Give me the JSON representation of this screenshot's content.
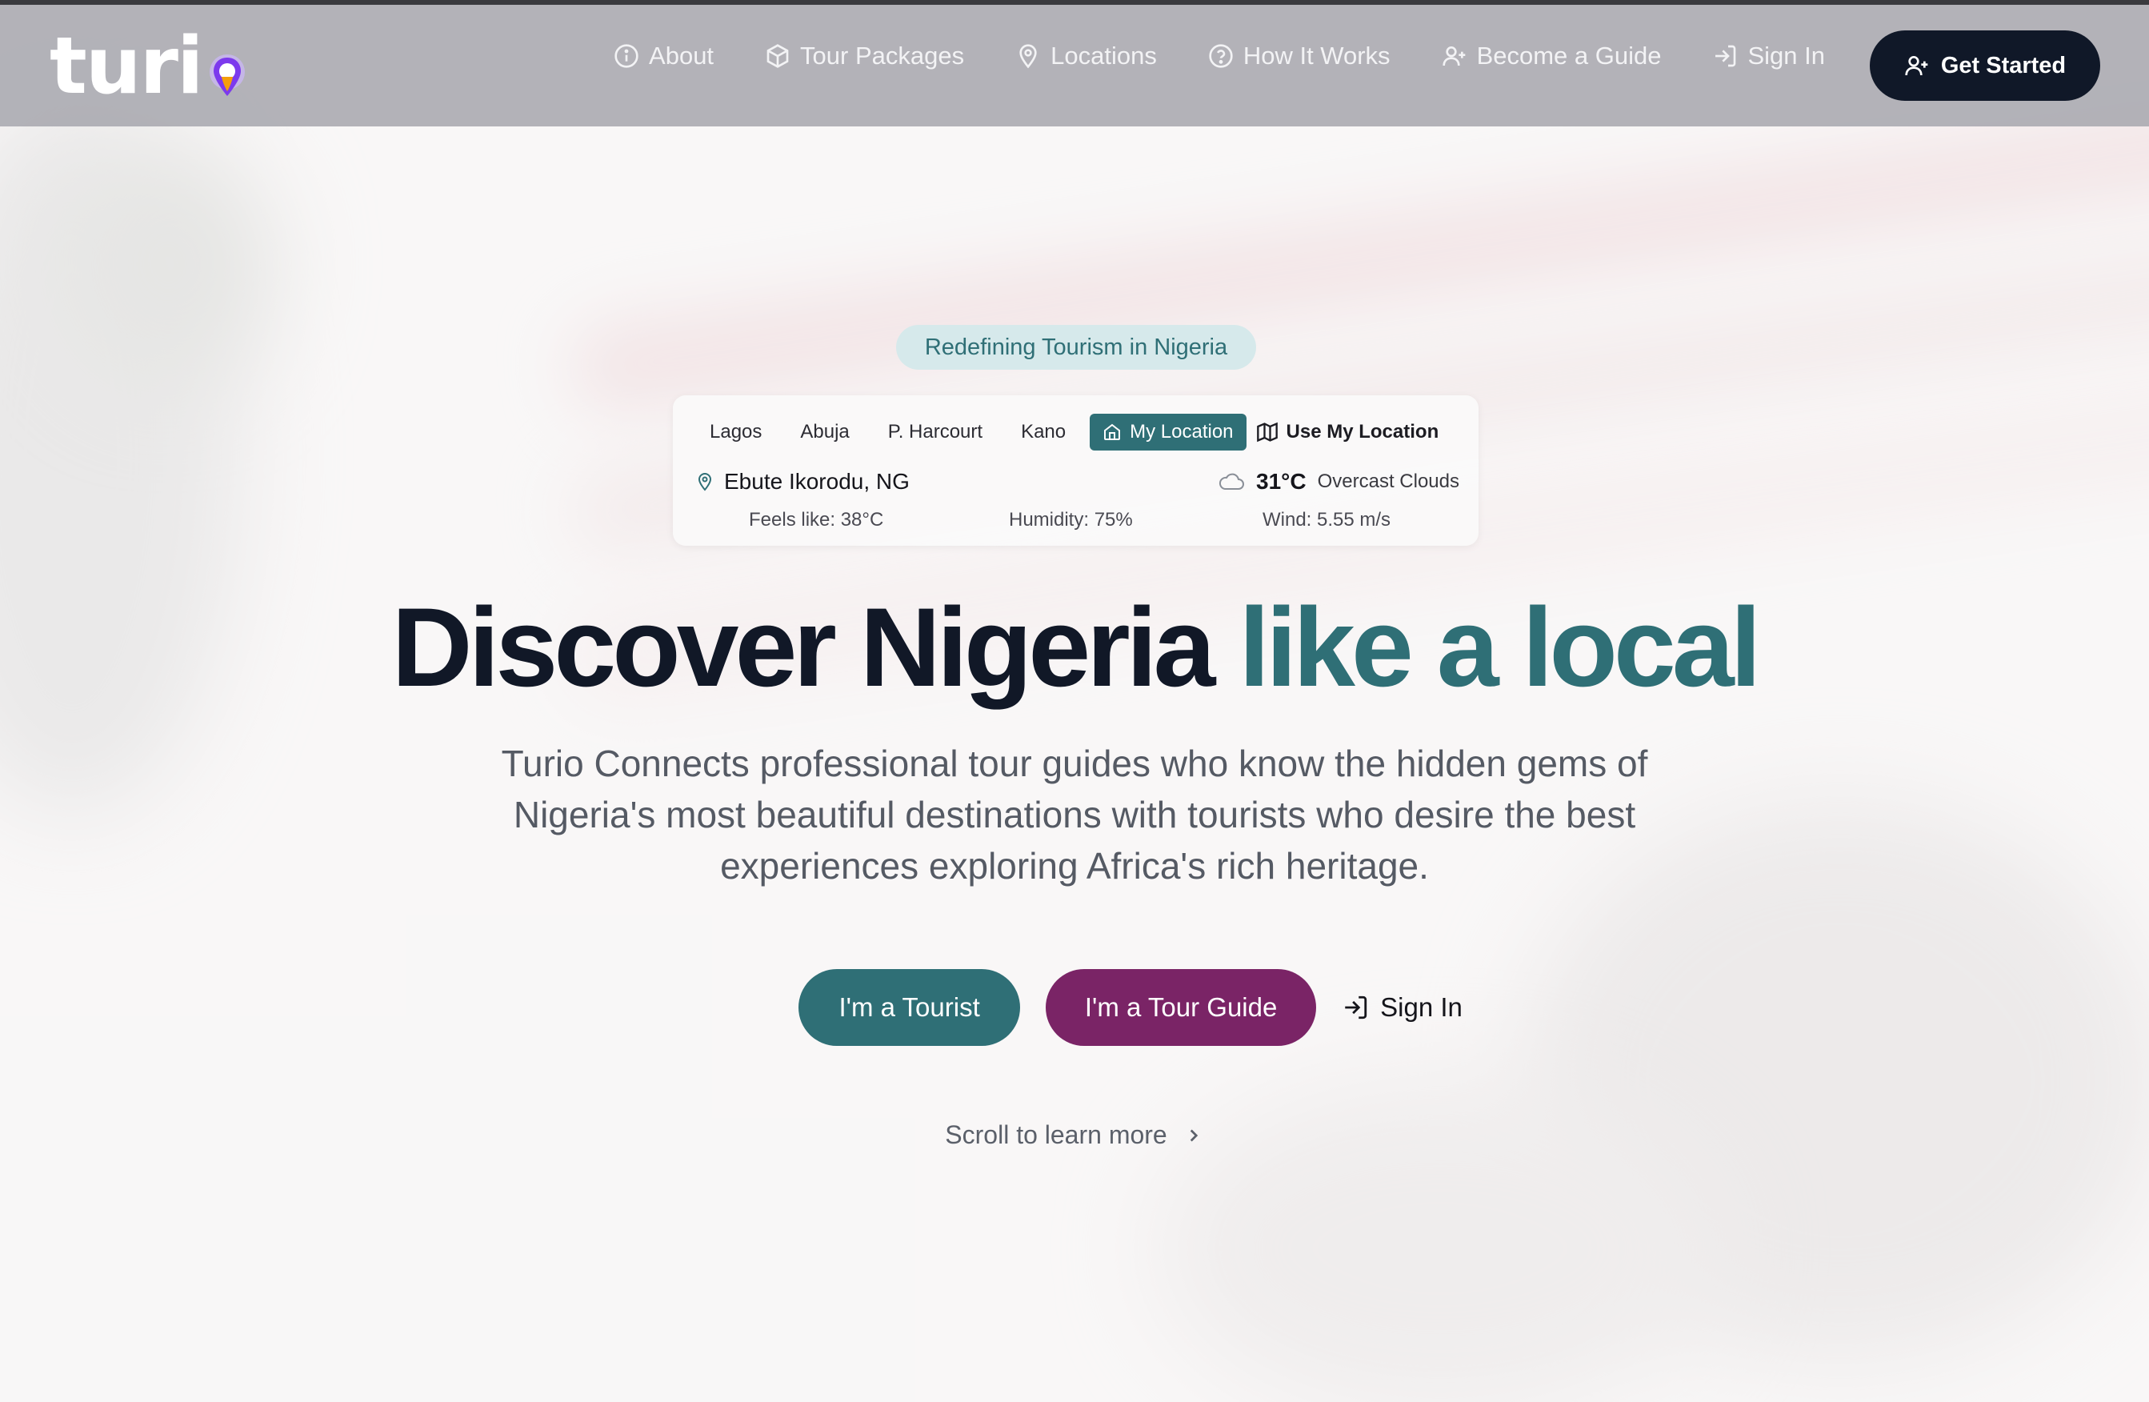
{
  "brand": {
    "logo_text": "turi"
  },
  "nav": {
    "links": [
      {
        "label": "About",
        "icon": "info-icon"
      },
      {
        "label": "Tour Packages",
        "icon": "package-icon"
      },
      {
        "label": "Locations",
        "icon": "map-pin-icon"
      },
      {
        "label": "How It Works",
        "icon": "help-circle-icon"
      },
      {
        "label": "Become a Guide",
        "icon": "user-plus-icon"
      },
      {
        "label": "Sign In",
        "icon": "log-in-icon"
      }
    ],
    "cta_label": "Get Started"
  },
  "hero": {
    "badge": "Redefining Tourism in Nigeria",
    "headline_main": "Discover Nigeria",
    "headline_accent": "like a local",
    "subtitle": "Turio Connects professional tour guides who know the hidden gems of Nigeria's most beautiful destinations with tourists who desire the best experiences exploring Africa's rich heritage.",
    "tourist_button": "I'm a Tourist",
    "guide_button": "I'm a Tour Guide",
    "signin_button": "Sign In",
    "scroll_hint": "Scroll to learn more"
  },
  "weather": {
    "tabs": [
      "Lagos",
      "Abuja",
      "P. Harcourt",
      "Kano"
    ],
    "active_tab": "My Location",
    "use_location": "Use My Location",
    "place": "Ebute Ikorodu, NG",
    "temperature": "31°C",
    "description": "Overcast Clouds",
    "feels_like": "Feels like: 38°C",
    "humidity": "Humidity: 75%",
    "wind": "Wind: 5.55 m/s"
  },
  "colors": {
    "brand_teal": "#2f6f76",
    "brand_plum": "#7a2466",
    "dark_navy": "#101828",
    "logo_pin_purple": "#7c3aed",
    "logo_pin_orange": "#f59e0b"
  }
}
